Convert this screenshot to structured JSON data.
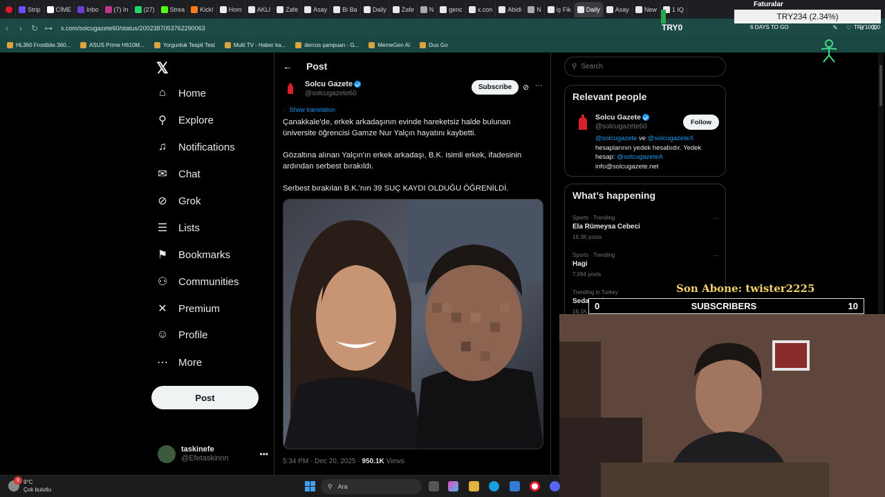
{
  "browser": {
    "tabs": [
      {
        "label": "Strip",
        "color": "#6d4cff"
      },
      {
        "label": "CİME",
        "color": "#ffffff"
      },
      {
        "label": "Inbo",
        "color": "#6e3ed1"
      },
      {
        "label": "(7) In",
        "color": "#c13584"
      },
      {
        "label": "(27)",
        "color": "#25d366"
      },
      {
        "label": "Strea",
        "color": "#53fc18"
      },
      {
        "label": "Kick!",
        "color": "#ff7a1a"
      },
      {
        "label": "Hom",
        "color": "#e7e9ea"
      },
      {
        "label": "AKLI",
        "color": "#e7e9ea"
      },
      {
        "label": "Zafe",
        "color": "#e7e9ea"
      },
      {
        "label": "Asay",
        "color": "#e7e9ea"
      },
      {
        "label": "Bi Ba",
        "color": "#e7e9ea"
      },
      {
        "label": "Daily",
        "color": "#e7e9ea"
      },
      {
        "label": "Zafe",
        "color": "#e7e9ea"
      },
      {
        "label": "N",
        "color": "#aaaaaa"
      },
      {
        "label": "genc",
        "color": "#e7e9ea"
      },
      {
        "label": "x.con",
        "color": "#e7e9ea"
      },
      {
        "label": "Abidi",
        "color": "#e7e9ea"
      },
      {
        "label": "N",
        "color": "#aaaaaa"
      },
      {
        "label": "iş Fik",
        "color": "#e7e9ea"
      },
      {
        "label": "Daily",
        "color": "#e7e9ea"
      },
      {
        "label": "Asay",
        "color": "#e7e9ea"
      },
      {
        "label": "New",
        "color": "#e7e9ea"
      },
      {
        "label": "1 IQ",
        "color": "#e7e9ea"
      }
    ],
    "active_tab_index": 20,
    "url": "x.com/solcugazete60/status/2002387053762290063",
    "bookmarks": [
      "HL360 Frostbite 360...",
      "ASUS Prime H610M...",
      "Yorgunluk Tespit Test",
      "Multi TV - Haber ka...",
      "dercos şampuan - G...",
      "MemeGen AI",
      "Duo Go"
    ]
  },
  "stream_overlay": {
    "faturalar": "Faturalar",
    "try_value": "TRY234 (2.34%)",
    "try_progress_pct": 2.34,
    "try_start": "TRY0",
    "days_to_go": "6 DAYS TO GO",
    "try_goal": "TRY10000",
    "son_abone": "Son Abone: twister2225",
    "subscribers_label": "SUBSCRIBERS",
    "subscribers_current": "0",
    "subscribers_goal": "10"
  },
  "sidebar": {
    "items": [
      {
        "label": "Home",
        "icon": "home-icon"
      },
      {
        "label": "Explore",
        "icon": "search-icon"
      },
      {
        "label": "Notifications",
        "icon": "bell-icon"
      },
      {
        "label": "Chat",
        "icon": "mail-icon"
      },
      {
        "label": "Grok",
        "icon": "grok-icon"
      },
      {
        "label": "Lists",
        "icon": "list-icon"
      },
      {
        "label": "Bookmarks",
        "icon": "bookmark-icon"
      },
      {
        "label": "Communities",
        "icon": "people-icon"
      },
      {
        "label": "Premium",
        "icon": "x-icon"
      },
      {
        "label": "Profile",
        "icon": "person-icon"
      },
      {
        "label": "More",
        "icon": "more-icon"
      }
    ],
    "post_button": "Post",
    "account": {
      "name": "taskinefe",
      "handle": "@Efetaskinnn"
    }
  },
  "post": {
    "header": "Post",
    "author_name": "Solcu Gazete",
    "author_handle": "@solcugazete60",
    "subscribe_label": "Subscribe",
    "show_translation": "Show translation",
    "paragraphs": [
      "Çanakkale'de, erkek arkadaşının evinde hareketsiz halde bulunan üniversite öğrencisi Gamze Nur Yalçın hayatını kaybetti.",
      "Gözaltına alınan Yalçın'ın erkek arkadaşı, B.K. isimli erkek, ifadesinin ardından serbest bırakıldı.",
      "Serbest bırakılan B.K.'nın 39 SUÇ KAYDI OLDUĞU ÖĞRENİLDİ."
    ],
    "timestamp": "5:34 PM · Dec 20, 2025 · ",
    "views_count": "950.1K",
    "views_label": " Views"
  },
  "right": {
    "search_placeholder": "Search",
    "relevant_title": "Relevant people",
    "relevant": {
      "name": "Solcu Gazete",
      "handle": "@solcugazete60",
      "follow_label": "Follow",
      "bio_link1": "@solcugazete",
      "bio_mid": " ve ",
      "bio_link2": "@solcugazeteX",
      "bio_text": " hesaplarının yedek hesabıdır. Yedek hesap: ",
      "bio_link3": "@solcugazeteA",
      "bio_email": "info@solcugazete.net"
    },
    "happening_title": "What’s happening",
    "trends": [
      {
        "category": "Sports · Trending",
        "title": "Ela Rümeysa Cebeci",
        "count": "16.3K posts"
      },
      {
        "category": "Sports · Trending",
        "title": "Hagi",
        "count": "7,994 posts"
      },
      {
        "category": "Trending in Turkey",
        "title": "Sedat Ecker",
        "count": "16.1K posts"
      }
    ]
  },
  "taskbar": {
    "weather_temp": "9°C",
    "weather_desc": "Çok bulutlu",
    "weather_badge": "9",
    "search_label": "Ara"
  }
}
